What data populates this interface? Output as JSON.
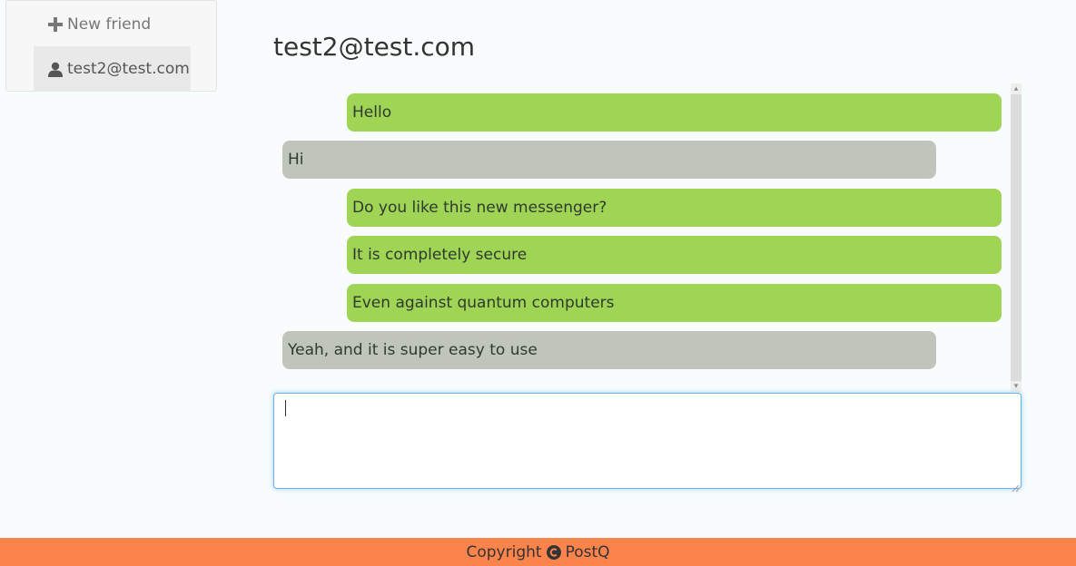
{
  "sidebar": {
    "new_friend": {
      "label": "New friend",
      "icon": "plus-icon"
    },
    "contacts": [
      {
        "label": "test2@test.com",
        "icon": "user-icon",
        "active": true
      }
    ]
  },
  "chat": {
    "title": "test2@test.com",
    "messages": [
      {
        "text": "Hello",
        "direction": "outgoing"
      },
      {
        "text": "Hi",
        "direction": "incoming"
      },
      {
        "text": "Do you like this new messenger?",
        "direction": "outgoing"
      },
      {
        "text": "It is completely secure",
        "direction": "outgoing"
      },
      {
        "text": "Even against quantum computers",
        "direction": "outgoing"
      },
      {
        "text": "Yeah, and it is super easy to use",
        "direction": "incoming"
      }
    ],
    "composer": {
      "value": "",
      "placeholder": ""
    }
  },
  "footer": {
    "prefix": "Copyright",
    "icon": "copyright-icon",
    "brand": "PostQ"
  },
  "colors": {
    "outgoing": "#9fd455",
    "incoming": "#bfc5bb",
    "footer": "#fb844d",
    "focus": "#66afe9"
  }
}
